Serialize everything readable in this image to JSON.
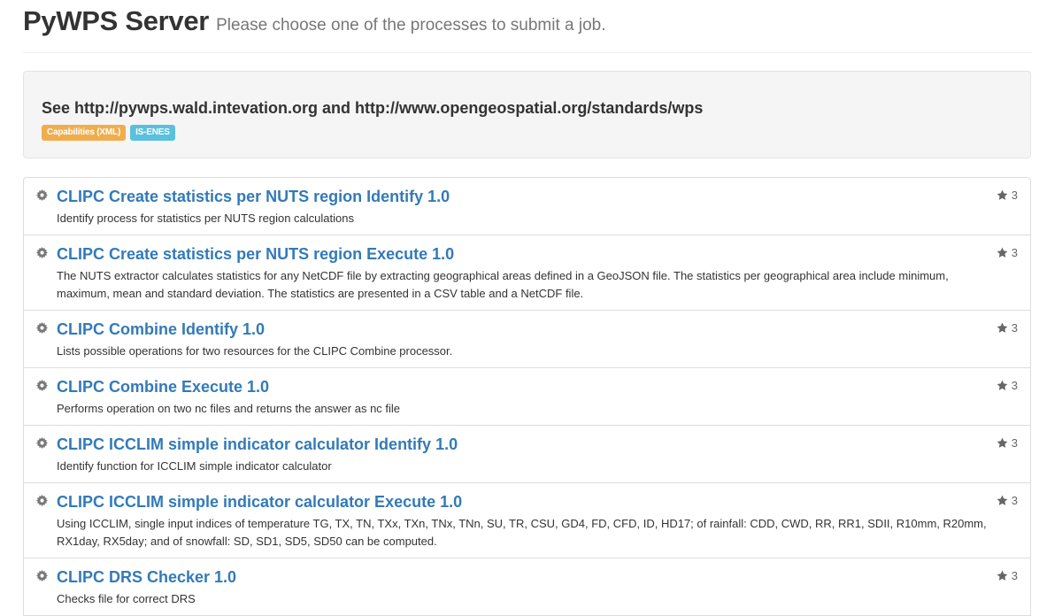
{
  "header": {
    "title": "PyWPS Server",
    "subtitle": "Please choose one of the processes to submit a job."
  },
  "jumbotron": {
    "text": "See http://pywps.wald.intevation.org and http://www.opengeospatial.org/standards/wps",
    "badges": [
      {
        "label": "Capabilities (XML)",
        "color": "#f0ad4e"
      },
      {
        "label": "IS-ENES",
        "color": "#5bc0de"
      }
    ]
  },
  "processes": [
    {
      "title": "CLIPC Create statistics per NUTS region Identify 1.0",
      "description": "Identify process for statistics per NUTS region calculations",
      "stars": "3",
      "icon": "gear-icon"
    },
    {
      "title": "CLIPC Create statistics per NUTS region Execute 1.0",
      "description": "The NUTS extractor calculates statistics for any NetCDF file by extracting geographical areas defined in a GeoJSON file. The statistics per geographical area include minimum, maximum, mean and standard deviation. The statistics are presented in a CSV table and a NetCDF file.",
      "stars": "3",
      "icon": "gear-icon"
    },
    {
      "title": "CLIPC Combine Identify 1.0",
      "description": "Lists possible operations for two resources for the CLIPC Combine processor.",
      "stars": "3",
      "icon": "gear-icon"
    },
    {
      "title": "CLIPC Combine Execute 1.0",
      "description": "Performs operation on two nc files and returns the answer as nc file",
      "stars": "3",
      "icon": "gear-icon"
    },
    {
      "title": "CLIPC ICCLIM simple indicator calculator Identify 1.0",
      "description": "Identify function for ICCLIM simple indicator calculator",
      "stars": "3",
      "icon": "gear-icon"
    },
    {
      "title": "CLIPC ICCLIM simple indicator calculator Execute 1.0",
      "description": "Using ICCLIM, single input indices of temperature TG, TX, TN, TXx, TXn, TNx, TNn, SU, TR, CSU, GD4, FD, CFD, ID, HD17; of rainfall: CDD, CWD, RR, RR1, SDII, R10mm, R20mm, RX1day, RX5day; and of snowfall: SD, SD1, SD5, SD50 can be computed.",
      "stars": "3",
      "icon": "gear-icon"
    },
    {
      "title": "CLIPC DRS Checker 1.0",
      "description": "Checks file for correct DRS",
      "stars": "3",
      "icon": "gear-icon"
    }
  ],
  "colors": {
    "link": "#337ab7",
    "star": "#666666"
  }
}
